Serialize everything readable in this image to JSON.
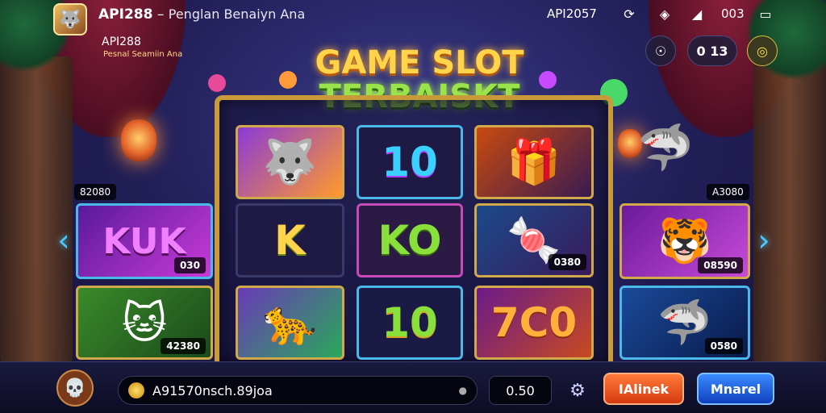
{
  "header": {
    "window_title_main": "API288",
    "window_title_separator": " – ",
    "window_title_sub": "Penglan Benaiyn Ana",
    "app_name": "API288",
    "app_tagline": "Pesnal Seamiin Ana",
    "status_id": "API2057",
    "status_text": "003",
    "status_icons": [
      "sync-icon",
      "shield-icon",
      "signal-icon",
      "battery-icon"
    ],
    "round_buttons": [
      "alien-icon",
      "0 13",
      "chat-icon"
    ]
  },
  "title": {
    "line1": "GAME SLOT",
    "line2": "TERBAISKT"
  },
  "reels": {
    "col_left_badges": [
      "82080",
      "030",
      "42380"
    ],
    "col_right_badges": [
      "A3080",
      "08590",
      "0580"
    ],
    "center_col_1": {
      "badge": "0380",
      "tile_text": "10"
    },
    "tiles_text": {
      "left_top": "KUK",
      "center_mid_1": "K",
      "center_mid_2": "KO",
      "center_bottom_2": "10",
      "center_top_2": "10",
      "right_bottom": "7C0"
    }
  },
  "bottom": {
    "account_text": "A91570nsch.89joa",
    "bet_value": "0.50",
    "primary_button": "IAlinek",
    "secondary_button": "Mnarel"
  },
  "colors": {
    "accent_gold": "#c99a3a",
    "accent_blue": "#4ab8e8",
    "primary_btn": "#ff7a3a",
    "secondary_btn": "#3a8aff"
  }
}
